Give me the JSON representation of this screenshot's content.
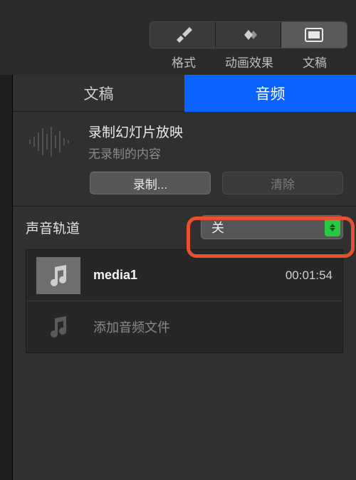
{
  "top_tabs": {
    "format": "格式",
    "animate": "动画效果",
    "document": "文稿"
  },
  "sub_tabs": {
    "document": "文稿",
    "audio": "音频"
  },
  "record": {
    "title": "录制幻灯片放映",
    "subtitle": "无录制的内容",
    "record_btn": "录制...",
    "clear_btn": "清除"
  },
  "soundtrack": {
    "label": "声音轨道",
    "dropdown_value": "关"
  },
  "media": [
    {
      "name": "media1",
      "duration": "00:01:54"
    }
  ],
  "add_media_label": "添加音频文件"
}
